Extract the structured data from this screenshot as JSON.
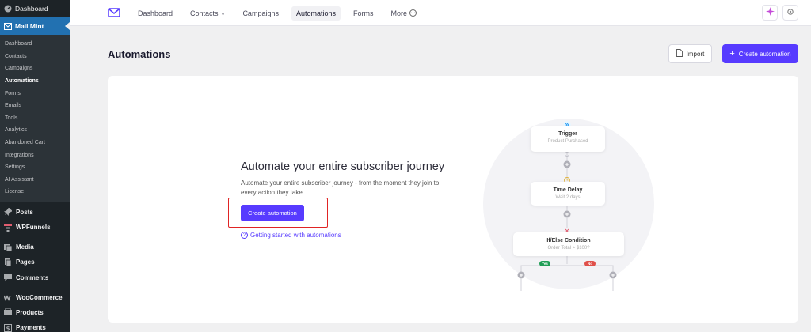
{
  "wp_sidebar": {
    "dashboard": "Dashboard",
    "active_plugin": "Mail Mint",
    "submenu": [
      "Dashboard",
      "Contacts",
      "Campaigns",
      "Automations",
      "Forms",
      "Emails",
      "Tools",
      "Analytics",
      "Abandoned Cart",
      "Integrations",
      "Settings",
      "AI Assistant",
      "License"
    ],
    "current_submenu": "Automations",
    "menu": [
      {
        "label": "Posts",
        "icon": "pin-icon"
      },
      {
        "label": "WPFunnels",
        "icon": "funnel-icon"
      },
      {
        "label": "Media",
        "icon": "media-icon"
      },
      {
        "label": "Pages",
        "icon": "pages-icon"
      },
      {
        "label": "Comments",
        "icon": "comment-icon"
      },
      {
        "label": "WooCommerce",
        "icon": "woo-icon"
      },
      {
        "label": "Products",
        "icon": "products-icon"
      },
      {
        "label": "Payments",
        "icon": "payments-icon"
      }
    ]
  },
  "topnav": {
    "links": [
      "Dashboard",
      "Contacts",
      "Campaigns",
      "Automations",
      "Forms",
      "More"
    ],
    "active": "Automations"
  },
  "page": {
    "title": "Automations",
    "import_label": "Import",
    "create_label": "Create automation"
  },
  "empty_state": {
    "headline": "Automate your entire subscriber journey",
    "description": "Automate your entire subscriber journey - from the moment they join to every action they take.",
    "button_label": "Create automation",
    "help_link": "Getting started with automations"
  },
  "flow": {
    "trigger_title": "Trigger",
    "trigger_sub": "Product Purchased",
    "delay_title": "Time Delay",
    "delay_sub": "Wait 2 days",
    "condition_title": "If/Else Condition",
    "condition_sub": "Order Total > $100?",
    "yes_label": "Yes",
    "no_label": "No"
  },
  "colors": {
    "accent": "#573bff",
    "wp_sidebar": "#1d2327",
    "wp_active": "#2271b1",
    "highlight": "#e02424",
    "yes": "#1f9d55",
    "no": "#e0504a"
  }
}
